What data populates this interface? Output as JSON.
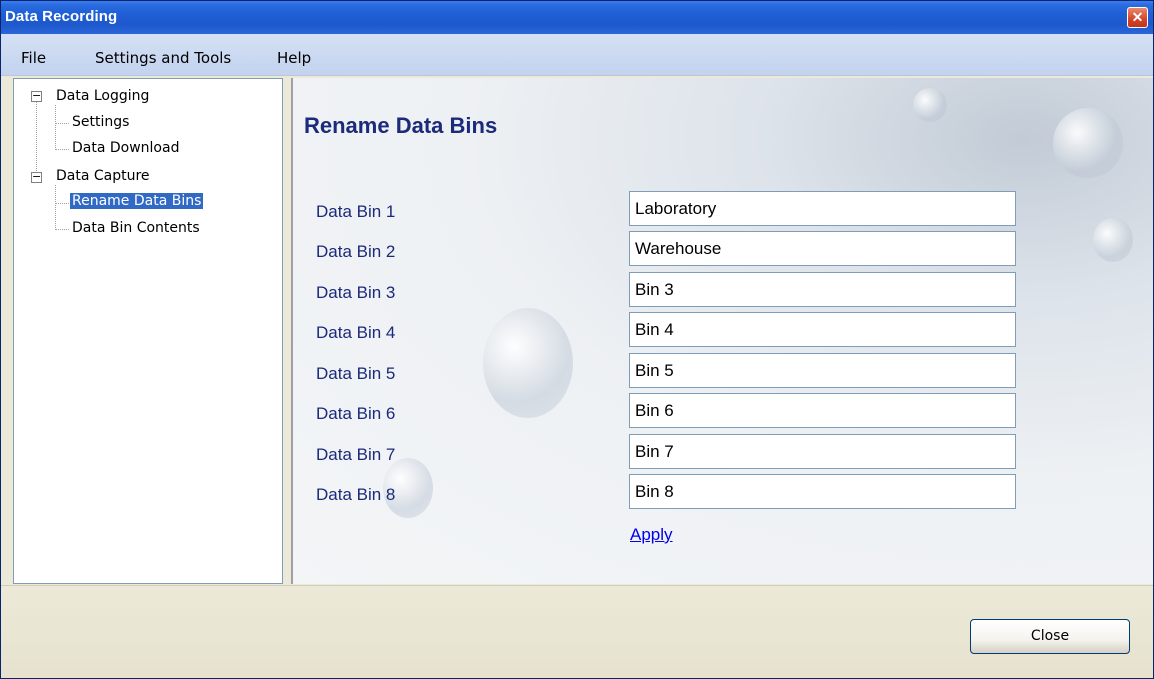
{
  "window": {
    "title": "Data Recording",
    "close_glyph": "✕"
  },
  "menu": {
    "file": "File",
    "settings": "Settings and Tools",
    "help": "Help"
  },
  "tree": {
    "expand_glyph": "−",
    "data_logging": "Data Logging",
    "settings": "Settings",
    "data_download": "Data Download",
    "data_capture": "Data Capture",
    "rename_data_bins": "Rename Data Bins",
    "data_bin_contents": "Data Bin Contents"
  },
  "main": {
    "title": "Rename Data Bins",
    "bins": [
      {
        "label": "Data Bin 1",
        "value": "Laboratory"
      },
      {
        "label": "Data Bin 2",
        "value": "Warehouse"
      },
      {
        "label": "Data Bin 3",
        "value": "Bin 3"
      },
      {
        "label": "Data Bin 4",
        "value": "Bin 4"
      },
      {
        "label": "Data Bin 5",
        "value": "Bin 5"
      },
      {
        "label": "Data Bin 6",
        "value": "Bin 6"
      },
      {
        "label": "Data Bin 7",
        "value": "Bin 7"
      },
      {
        "label": "Data Bin 8",
        "value": "Bin 8"
      }
    ],
    "apply": "Apply"
  },
  "footer": {
    "close": "Close"
  },
  "colors": {
    "title_blue": "#1b2a7a",
    "selection": "#316ac5",
    "link": "#0000ee"
  }
}
